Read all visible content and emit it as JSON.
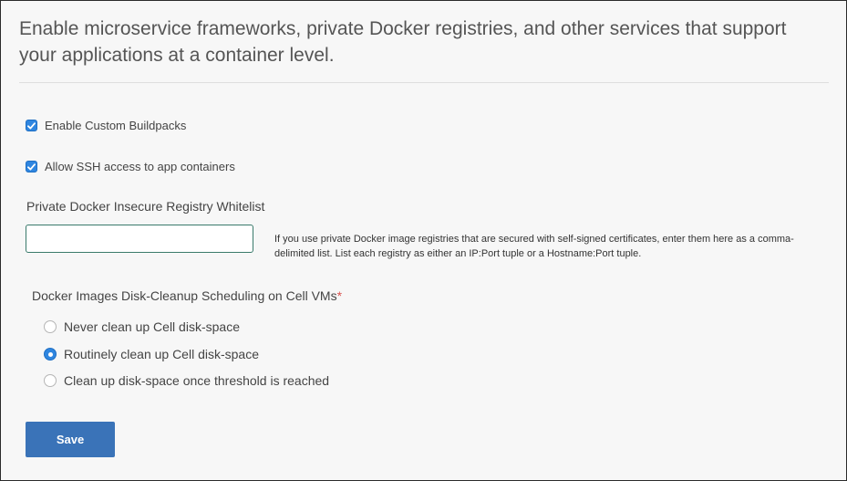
{
  "intro": {
    "text": "Enable microservice frameworks, private Docker registries, and other services that support your applications at a container level."
  },
  "checkboxes": [
    {
      "label": "Enable Custom Buildpacks",
      "checked": true
    },
    {
      "label": "Allow SSH access to app containers",
      "checked": true
    }
  ],
  "whitelist": {
    "label": "Private Docker Insecure Registry Whitelist",
    "value": "",
    "help": "If you use private Docker image registries that are secured with self-signed certificates, enter them here as a comma-delimited list. List each registry as either an IP:Port tuple or a Hostname:Port tuple."
  },
  "cleanup": {
    "label": "Docker Images Disk-Cleanup Scheduling on Cell VMs",
    "required_mark": "*",
    "options": [
      {
        "label": "Never clean up Cell disk-space",
        "selected": false
      },
      {
        "label": "Routinely clean up Cell disk-space",
        "selected": true
      },
      {
        "label": "Clean up disk-space once threshold is reached",
        "selected": false
      }
    ]
  },
  "actions": {
    "save_label": "Save"
  },
  "colors": {
    "accent": "#2f86e0",
    "button": "#3a73b8",
    "required": "#d9534f"
  }
}
